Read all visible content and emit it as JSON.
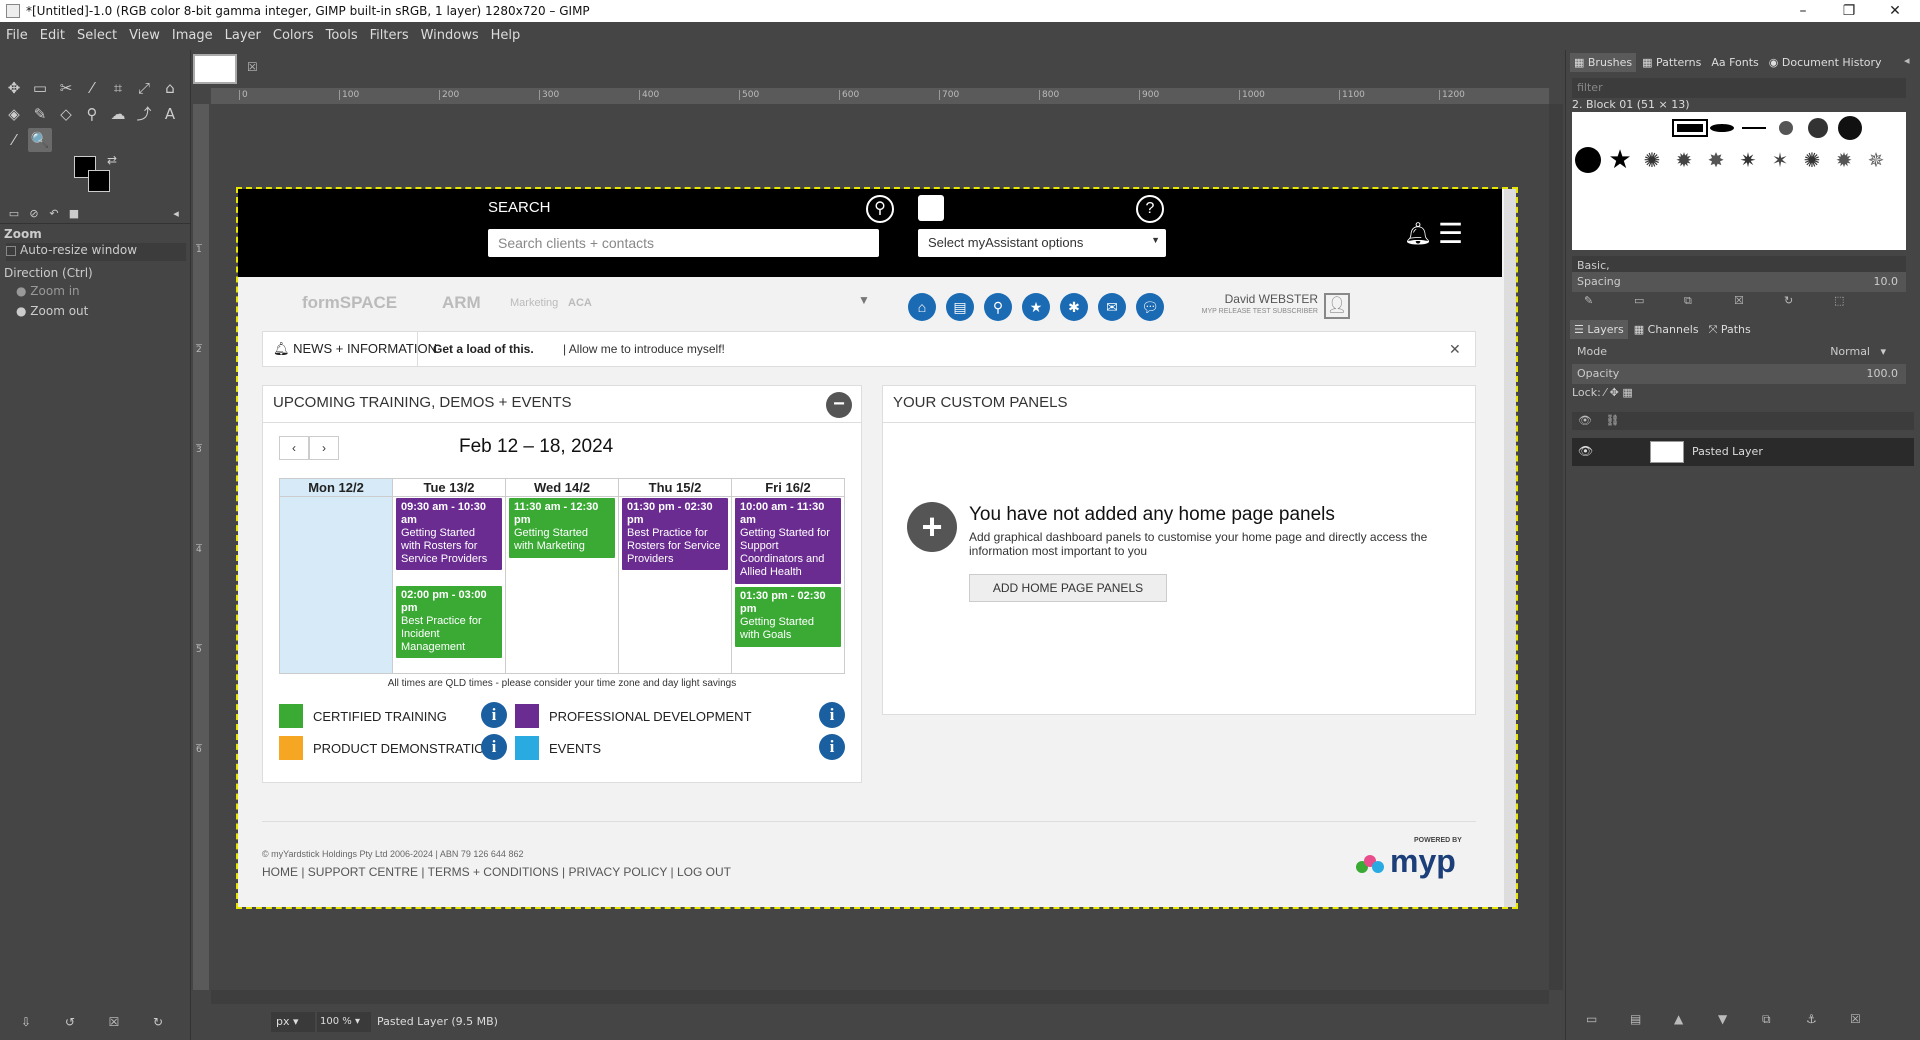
{
  "window": {
    "title": "*[Untitled]-1.0 (RGB color 8-bit gamma integer, GIMP built-in sRGB, 1 layer) 1280x720 – GIMP"
  },
  "menu": [
    "File",
    "Edit",
    "Select",
    "View",
    "Image",
    "Layer",
    "Colors",
    "Tools",
    "Filters",
    "Windows",
    "Help"
  ],
  "tool_options": {
    "title": "Zoom",
    "auto_resize": "Auto-resize window",
    "direction": "Direction  (Ctrl)",
    "zoom_in": "Zoom in",
    "zoom_out": "Zoom out"
  },
  "ruler_ticks": [
    "0",
    "100",
    "200",
    "300",
    "400",
    "500",
    "600",
    "700",
    "800",
    "900",
    "1000",
    "1100",
    "1200"
  ],
  "ruler_v_ticks": [
    "1",
    "2",
    "3",
    "4",
    "5",
    "6"
  ],
  "site": {
    "search_label": "SEARCH",
    "search_placeholder": "Search clients + contacts",
    "assistant_select": "Select myAssistant options",
    "user_name": "David WEBSTER",
    "user_sub": "MYP RELEASE TEST SUBSCRIBER",
    "logos": [
      "formSPACE",
      "ARM",
      "Marketing",
      "ACA"
    ],
    "news_label": "NEWS + INFORMATION",
    "news_bold": "Get a load of this.",
    "news_text": "Allow me to introduce myself!",
    "training": {
      "title": "UPCOMING TRAINING, DEMOS + EVENTS",
      "week": "Feb 12 – 18, 2024",
      "days": [
        "Mon 12/2",
        "Tue 13/2",
        "Wed 14/2",
        "Thu 15/2",
        "Fri 16/2"
      ],
      "events": [
        {
          "time": "09:30 am - 10:30 am",
          "title": "Getting Started with Rosters for Service Providers",
          "color": "#6b2c91"
        },
        {
          "time": "02:00 pm - 03:00 pm",
          "title": "Best Practice for Incident Management",
          "color": "#3aaa35"
        },
        {
          "time": "11:30 am - 12:30 pm",
          "title": "Getting Started with Marketing",
          "color": "#3aaa35"
        },
        {
          "time": "01:30 pm - 02:30 pm",
          "title": "Best Practice for Rosters for Service Providers",
          "color": "#6b2c91"
        },
        {
          "time": "10:00 am - 11:30 am",
          "title": "Getting Started for Support Coordinators and Allied Health",
          "color": "#6b2c91"
        },
        {
          "time": "01:30 pm - 02:30 pm",
          "title": "Getting Started with Goals",
          "color": "#3aaa35"
        }
      ],
      "tz_note": "All times are QLD times - please consider your time zone and day light savings",
      "legend": [
        {
          "label": "CERTIFIED TRAINING",
          "color": "#3aaa35"
        },
        {
          "label": "PROFESSIONAL DEVELOPMENT",
          "color": "#6b2c91"
        },
        {
          "label": "PRODUCT DEMONSTRATIONS",
          "color": "#f5a623"
        },
        {
          "label": "EVENTS",
          "color": "#29abe2"
        }
      ]
    },
    "custom": {
      "title": "YOUR CUSTOM PANELS",
      "heading": "You have not added any home page panels",
      "desc": "Add graphical dashboard panels to customise your home page and directly access the information most important to you",
      "button": "ADD HOME PAGE PANELS"
    },
    "footer": {
      "copyright": "© myYardstick Holdings Pty Ltd 2006-2024 | ABN 79 126 644 862",
      "links": [
        "HOME",
        "SUPPORT CENTRE",
        "TERMS + CONDITIONS",
        "PRIVACY POLICY",
        "LOG OUT"
      ],
      "powered": "POWERED BY",
      "brand": "myp"
    }
  },
  "status": {
    "unit": "px",
    "zoom": "100 %",
    "layer_info": "Pasted Layer (9.5 MB)"
  },
  "dock": {
    "tabs_top": [
      "Brushes",
      "Patterns",
      "Fonts",
      "Document History"
    ],
    "filter_placeholder": "filter",
    "brush_name": "2. Block 01 (51 × 13)",
    "brush_set": "Basic,",
    "spacing_label": "Spacing",
    "spacing_value": "10.0",
    "tabs_bottom": [
      "Layers",
      "Channels",
      "Paths"
    ],
    "mode_label": "Mode",
    "mode_value": "Normal",
    "opacity_label": "Opacity",
    "opacity_value": "100.0",
    "lock_label": "Lock:",
    "layer_name": "Pasted Layer"
  }
}
